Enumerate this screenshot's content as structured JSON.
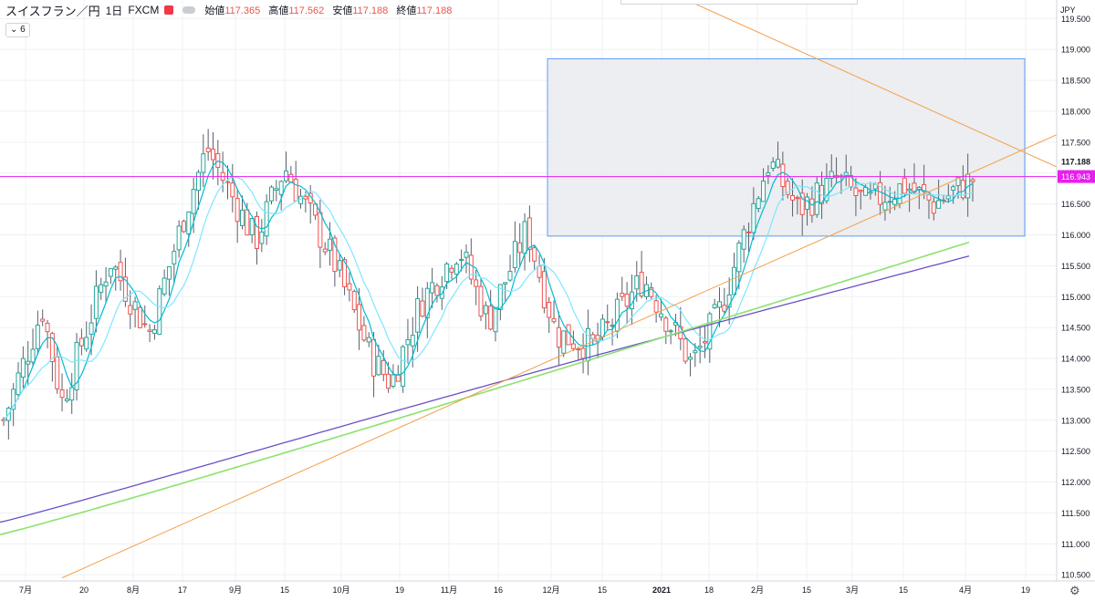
{
  "header": {
    "symbol": "スイスフラン／円",
    "interval": "1日",
    "source": "FXCM",
    "open_label": "始値",
    "open": "117.365",
    "high_label": "高値",
    "high": "117.562",
    "low_label": "安値",
    "low": "117.188",
    "close_label": "終値",
    "close": "117.188"
  },
  "indicator_badge": "6",
  "currency": "JPY",
  "chart_data": {
    "type": "candlestick",
    "title": "スイスフラン／円 1日 FXCM",
    "ylim": [
      110.4,
      119.8
    ],
    "y_ticks": [
      "119.500",
      "119.000",
      "118.500",
      "118.000",
      "117.500",
      "117.000",
      "116.500",
      "116.000",
      "115.500",
      "115.000",
      "114.500",
      "114.000",
      "113.500",
      "113.000",
      "112.500",
      "112.000",
      "111.500",
      "111.000",
      "110.500"
    ],
    "x_ticks": [
      "7月",
      "20",
      "8月",
      "17",
      "9月",
      "15",
      "10月",
      "19",
      "11月",
      "16",
      "12月",
      "15",
      "2021",
      "18",
      "2月",
      "15",
      "3月",
      "15",
      "4月",
      "19"
    ],
    "last_price": "117.188",
    "horizontal_line_price": "116.943",
    "rectangle_price_range": [
      115.98,
      118.85
    ],
    "candle_anchors": [
      [
        113.0,
        0.0
      ],
      [
        114.8,
        0.04
      ],
      [
        113.3,
        0.06
      ],
      [
        115.6,
        0.11
      ],
      [
        114.4,
        0.15
      ],
      [
        116.5,
        0.19
      ],
      [
        117.4,
        0.21
      ],
      [
        115.9,
        0.26
      ],
      [
        117.1,
        0.29
      ],
      [
        115.6,
        0.34
      ],
      [
        114.0,
        0.38
      ],
      [
        113.6,
        0.4
      ],
      [
        114.9,
        0.43
      ],
      [
        115.8,
        0.47
      ],
      [
        114.6,
        0.5
      ],
      [
        116.1,
        0.54
      ],
      [
        114.4,
        0.57
      ],
      [
        114.2,
        0.61
      ],
      [
        115.3,
        0.66
      ],
      [
        114.5,
        0.69
      ],
      [
        113.9,
        0.71
      ],
      [
        114.8,
        0.74
      ],
      [
        116.3,
        0.77
      ],
      [
        117.2,
        0.79
      ],
      [
        116.4,
        0.82
      ],
      [
        116.9,
        0.86
      ],
      [
        116.5,
        0.89
      ],
      [
        116.8,
        0.93
      ],
      [
        116.5,
        0.96
      ],
      [
        116.9,
        1.0
      ]
    ],
    "candle_count": 200,
    "series": [
      {
        "name": "",
        "color": "#00bcd4",
        "values": []
      },
      {
        "name": "",
        "color": "#7fe6ff",
        "values": []
      },
      {
        "name": "",
        "color": "#6b4fc8",
        "values": []
      },
      {
        "name": "",
        "color": "#8ce26f",
        "values": []
      }
    ],
    "trendline_color": "#f4a04a",
    "up_color": "#26a69a",
    "down_color": "#ef5350",
    "hline_color": "#e91ef0",
    "rect_fill": "#e9ebef",
    "rect_stroke": "#5b9cf5",
    "grid": true
  }
}
